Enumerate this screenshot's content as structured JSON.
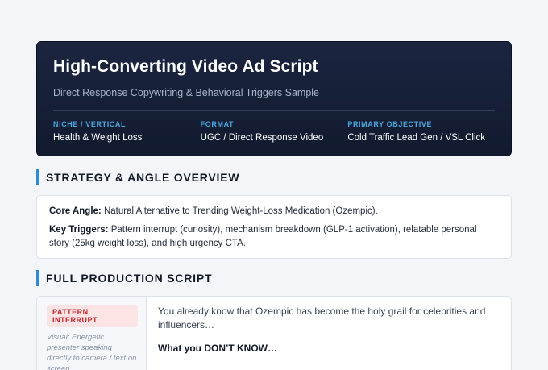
{
  "header": {
    "title": "High-Converting Video Ad Script",
    "subtitle": "Direct Response Copywriting & Behavioral Triggers Sample",
    "meta": [
      {
        "label": "NICHE / VERTICAL",
        "value": "Health & Weight Loss"
      },
      {
        "label": "FORMAT",
        "value": "UGC / Direct Response Video"
      },
      {
        "label": "PRIMARY OBJECTIVE",
        "value": "Cold Traffic Lead Gen / VSL Click"
      }
    ]
  },
  "strategy": {
    "section_title": "STRATEGY & ANGLE OVERVIEW",
    "core_angle_label": "Core Angle:",
    "core_angle_text": " Natural Alternative to Trending Weight-Loss Medication (Ozempic).",
    "key_triggers_label": "Key Triggers:",
    "key_triggers_text": " Pattern interrupt (curiosity), mechanism breakdown (GLP-1 activation), relatable personal story (25kg weight loss), and high urgency CTA."
  },
  "script": {
    "section_title": "FULL PRODUCTION SCRIPT",
    "rows": [
      {
        "tag": "PATTERN INTERRUPT",
        "visual": "Visual: Energetic presenter speaking directly to camera / text on screen",
        "line1": "You already know that Ozempic has become the holy grail for celebrities and influencers…",
        "line2": "What you DON’T KNOW…"
      }
    ]
  },
  "colors": {
    "hero_bg": "#141d33",
    "accent_blue": "#2b8ccf",
    "meta_label": "#4aa8e0",
    "tag_bg": "#fde4e4",
    "tag_text": "#c0262d"
  }
}
